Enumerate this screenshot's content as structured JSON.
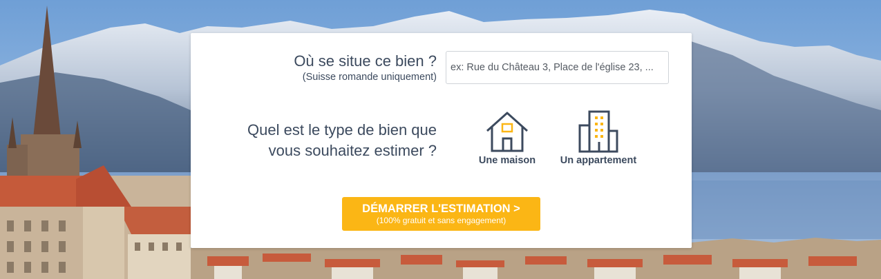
{
  "form": {
    "location_question": "Où se situe ce bien ?",
    "location_note": "(Suisse romande uniquement)",
    "address_placeholder": "ex: Rue du Château 3, Place de l'église 23, ...",
    "address_value": "",
    "type_question_line1": "Quel est le type de bien que",
    "type_question_line2": "vous souhaitez estimer ?",
    "types": [
      {
        "label": "Une maison",
        "icon": "house-icon"
      },
      {
        "label": "Un appartement",
        "icon": "apartment-building-icon"
      }
    ],
    "cta_label": "DÉMARRER L'ESTIMATION >",
    "cta_sub": "(100% gratuit et sans engagement)"
  },
  "colors": {
    "accent": "#fbb615",
    "text": "#3c4a5e",
    "icon_stroke": "#3c4a5e",
    "icon_accent": "#fbb615"
  }
}
